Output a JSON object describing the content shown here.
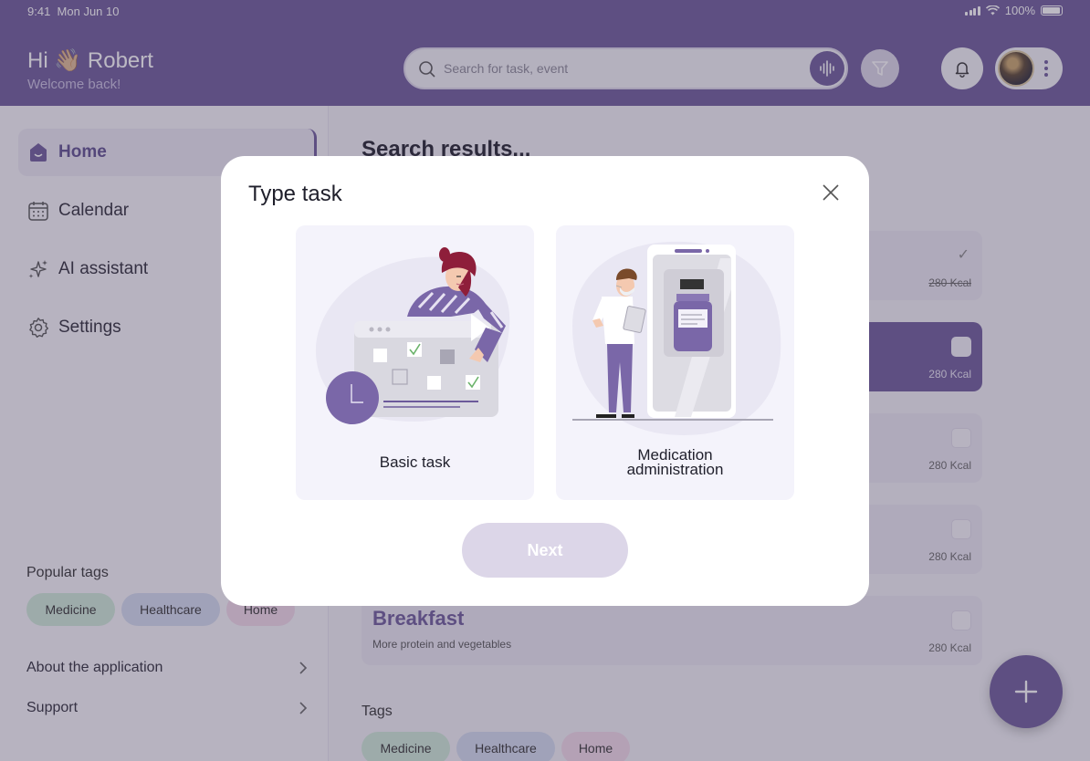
{
  "status": {
    "time": "9:41",
    "date": "Mon Jun 10",
    "battery": "100%"
  },
  "header": {
    "greeting": "Hi 👋🏼 Robert",
    "subtitle": "Welcome back!"
  },
  "search": {
    "placeholder": "Search for task, event"
  },
  "sidebar": {
    "items": [
      {
        "label": "Home"
      },
      {
        "label": "Calendar"
      },
      {
        "label": "AI assistant"
      },
      {
        "label": "Settings"
      }
    ],
    "popular_tags_title": "Popular tags",
    "tags": [
      "Medicine",
      "Healthcare",
      "Home"
    ],
    "links": [
      "About the application",
      "Support"
    ]
  },
  "main": {
    "title": "Search results...",
    "cards": [
      {
        "kcal": "280 Kcal"
      },
      {
        "kcal": "280 Kcal"
      },
      {
        "kcal": "280 Kcal"
      },
      {
        "kcal": "280 Kcal"
      },
      {
        "title": "Breakfast",
        "subtitle": "More protein and vegetables",
        "kcal": "280 Kcal"
      }
    ],
    "tags_title": "Tags",
    "tags": [
      "Medicine",
      "Healthcare",
      "Home"
    ]
  },
  "modal": {
    "title": "Type task",
    "options": [
      {
        "label": "Basic task"
      },
      {
        "label_line1": "Medication",
        "label_line2": "administration"
      }
    ],
    "next_label": "Next"
  },
  "colors": {
    "primary": "#6c5a9a",
    "primary_light": "#ebe8f3",
    "tag_green": "#cfe9d8",
    "tag_blue": "#d4dcef",
    "tag_pink": "#f3d9ea"
  }
}
